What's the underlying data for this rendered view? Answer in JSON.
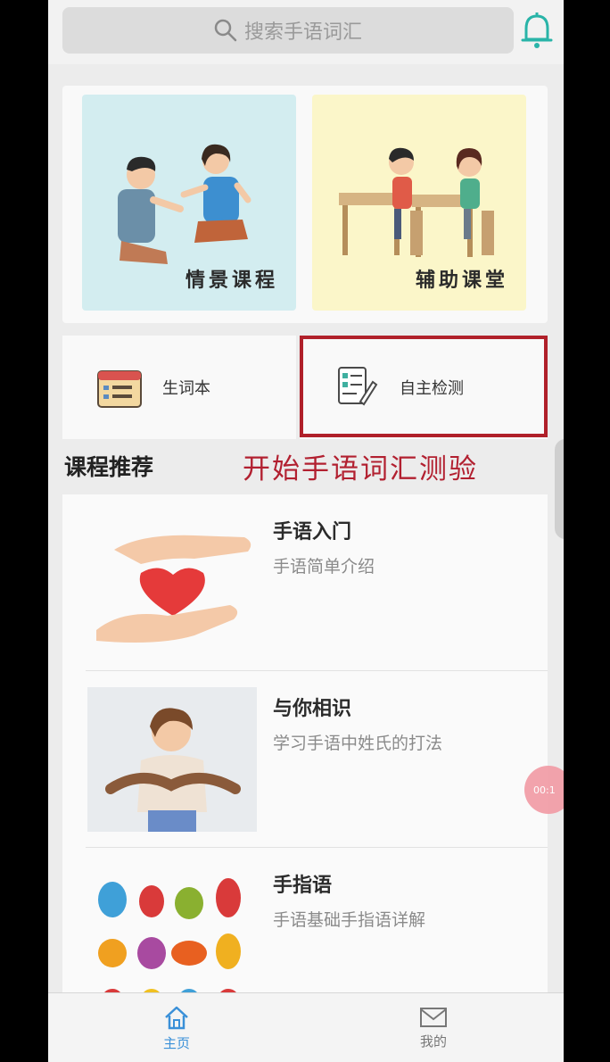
{
  "search": {
    "placeholder": "搜索手语词汇"
  },
  "banners": [
    {
      "label": "情景课程"
    },
    {
      "label": "辅助课堂"
    }
  ],
  "quick_actions": [
    {
      "label": "生词本",
      "icon": "calendar-icon"
    },
    {
      "label": "自主检测",
      "icon": "checklist-icon"
    }
  ],
  "section": {
    "title": "课程推荐",
    "annotation": "开始手语词汇测验"
  },
  "courses": [
    {
      "title": "手语入门",
      "desc": "手语简单介绍"
    },
    {
      "title": "与你相识",
      "desc": "学习手语中姓氏的打法"
    },
    {
      "title": "手指语",
      "desc": "手语基础手指语详解"
    }
  ],
  "fab": {
    "text": "00:1"
  },
  "nav": {
    "home": "主页",
    "mine": "我的"
  },
  "colors": {
    "accent": "#3a90d8",
    "highlight": "#b0202a",
    "annotation": "#b22030"
  }
}
